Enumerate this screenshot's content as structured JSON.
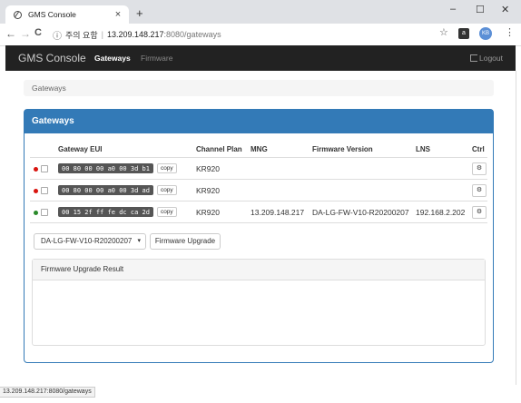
{
  "browser": {
    "tab_title": "GMS Console",
    "tab_close": "×",
    "new_tab": "+",
    "win_minimize": "–",
    "win_maximize": "☐",
    "win_close": "✕",
    "back": "←",
    "forward": "→",
    "reload": "C",
    "info_icon": "ⓘ",
    "security_warning": "주의 요함",
    "url_host": "13.209.148.217",
    "url_path": ":8080/gateways",
    "star": "☆",
    "ext_label": "a",
    "avatar_label": "KB",
    "menu": "⋮",
    "status_url": "13.209.148.217:8080/gateways"
  },
  "navbar": {
    "brand": "GMS Console",
    "links": [
      {
        "label": "Gateways",
        "active": true
      },
      {
        "label": "Firmware",
        "active": false
      }
    ],
    "logout": "Logout"
  },
  "breadcrumb": "Gateways",
  "panel": {
    "title": "Gateways",
    "columns": [
      "Gateway EUI",
      "Channel Plan",
      "MNG",
      "Firmware Version",
      "LNS",
      "Ctrl"
    ],
    "rows": [
      {
        "status_color": "#d9140e",
        "eui": "00 80 00 00 a0 00 3d b1",
        "copy": "copy",
        "channel_plan": "KR920",
        "mng": "",
        "firmware": "",
        "lns": "",
        "ctrl": "⚙"
      },
      {
        "status_color": "#d9140e",
        "eui": "00 80 00 00 a0 00 3d ad",
        "copy": "copy",
        "channel_plan": "KR920",
        "mng": "",
        "firmware": "",
        "lns": "",
        "ctrl": "⚙"
      },
      {
        "status_color": "#2a8a2a",
        "eui": "00 15 2f ff fe dc ca 2d",
        "copy": "copy",
        "channel_plan": "KR920",
        "mng": "13.209.148.217",
        "firmware": "DA-LG-FW-V10-R20200207",
        "lns": "192.168.2.202",
        "ctrl": "⚙"
      }
    ],
    "firmware_select": "DA-LG-FW-V10-R20200207",
    "firmware_select_arrow": "▾",
    "upgrade_button": "Firmware Upgrade",
    "result_title": "Firmware Upgrade Result"
  }
}
